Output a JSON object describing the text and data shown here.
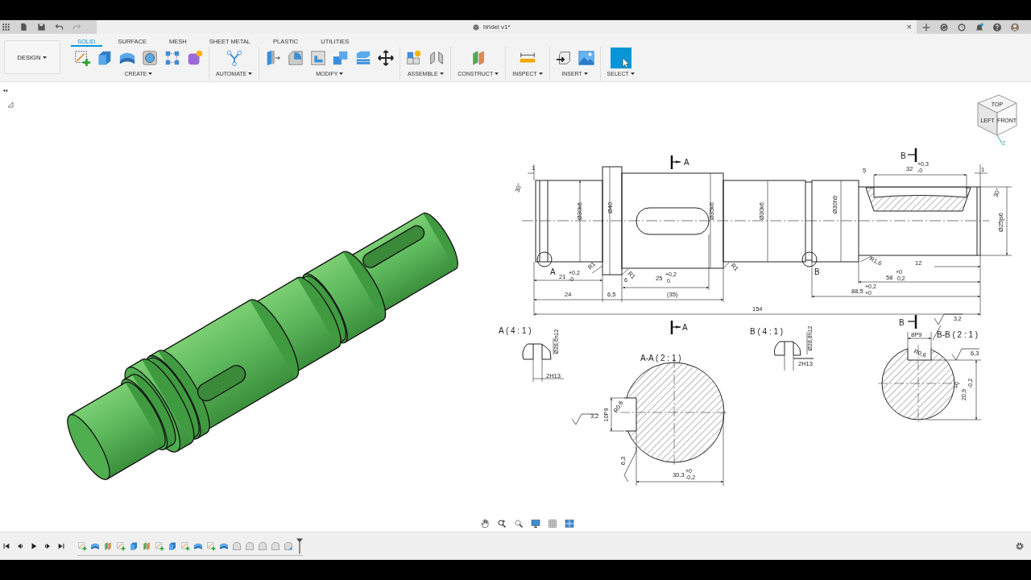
{
  "window": {
    "title": "hřídel v1*",
    "close_symbol": "×"
  },
  "workspace": {
    "label": "DESIGN"
  },
  "tabs": [
    {
      "label": "SOLID",
      "selected": true
    },
    {
      "label": "SURFACE",
      "selected": false
    },
    {
      "label": "MESH",
      "selected": false
    },
    {
      "label": "SHEET METAL",
      "selected": false
    },
    {
      "label": "PLASTIC",
      "selected": false
    },
    {
      "label": "UTILITIES",
      "selected": false
    }
  ],
  "tool_groups": [
    {
      "label": "CREATE"
    },
    {
      "label": "AUTOMATE"
    },
    {
      "label": "MODIFY"
    },
    {
      "label": "ASSEMBLE"
    },
    {
      "label": "CONSTRUCT"
    },
    {
      "label": "INSPECT"
    },
    {
      "label": "INSERT"
    },
    {
      "label": "SELECT"
    }
  ],
  "view_cube": {
    "faces": [
      "TOP",
      "LEFT",
      "FRONT"
    ],
    "axis": "Z"
  },
  "drawing": {
    "labels": [
      {
        "text": "A",
        "kind": "view"
      },
      {
        "text": "B",
        "kind": "view"
      },
      {
        "text": "1",
        "kind": "dim"
      },
      {
        "text": "30°",
        "kind": "dim"
      },
      {
        "text": "Ø30k6",
        "kind": "dim"
      },
      {
        "text": "Ø40",
        "kind": "dim"
      },
      {
        "text": "Ø35k6",
        "kind": "dim"
      },
      {
        "text": "Ø30k6",
        "kind": "dim"
      },
      {
        "text": "Ø30h9",
        "kind": "dim"
      },
      {
        "text": "5",
        "kind": "dim"
      },
      {
        "text": "32",
        "kind": "dim"
      },
      {
        "text": "+0,3",
        "kind": "tol"
      },
      {
        "text": "-0",
        "kind": "tol"
      },
      {
        "text": "1",
        "kind": "dim"
      },
      {
        "text": "30°",
        "kind": "dim"
      },
      {
        "text": "Ø25js6",
        "kind": "dim"
      },
      {
        "text": "A",
        "kind": "view"
      },
      {
        "text": "R1",
        "kind": "dim"
      },
      {
        "text": "21",
        "kind": "dim"
      },
      {
        "text": "+0,2",
        "kind": "tol"
      },
      {
        "text": "-0",
        "kind": "tol"
      },
      {
        "text": "R1",
        "kind": "dim"
      },
      {
        "text": "6",
        "kind": "tol"
      },
      {
        "text": "25",
        "kind": "dim"
      },
      {
        "text": "+0,2",
        "kind": "tol"
      },
      {
        "text": "0",
        "kind": "tol"
      },
      {
        "text": "R1",
        "kind": "dim"
      },
      {
        "text": "B",
        "kind": "view"
      },
      {
        "text": "R1,6",
        "kind": "dim"
      },
      {
        "text": "12",
        "kind": "dim"
      },
      {
        "text": "58",
        "kind": "dim"
      },
      {
        "text": "+0",
        "kind": "tol"
      },
      {
        "text": "0,2",
        "kind": "tol"
      },
      {
        "text": "24",
        "kind": "dim"
      },
      {
        "text": "6,5",
        "kind": "dim"
      },
      {
        "text": "(35)",
        "kind": "dim"
      },
      {
        "text": "88,5",
        "kind": "dim"
      },
      {
        "text": "+0,2",
        "kind": "tol"
      },
      {
        "text": "+0",
        "kind": "tol"
      },
      {
        "text": "154",
        "kind": "dim"
      },
      {
        "text": "A ( 4 : 1 )",
        "kind": "view"
      },
      {
        "text": "Ø28,6h12",
        "kind": "tol"
      },
      {
        "text": "2H13",
        "kind": "dim"
      },
      {
        "text": "A",
        "kind": "view"
      },
      {
        "text": "A-A ( 2 : 1 )",
        "kind": "view"
      },
      {
        "text": "B ( 4 : 1 )",
        "kind": "view"
      },
      {
        "text": "Ø28,8h12",
        "kind": "tol"
      },
      {
        "text": "2H13",
        "kind": "dim"
      },
      {
        "text": "B",
        "kind": "view"
      },
      {
        "text": "3,2",
        "kind": "tol"
      },
      {
        "text": "8P9",
        "kind": "dim"
      },
      {
        "text": "B-B ( 2 : 1 )",
        "kind": "view"
      },
      {
        "text": "R0,6",
        "kind": "dim"
      },
      {
        "text": "6,3",
        "kind": "dim"
      },
      {
        "text": "20,9",
        "kind": "dim"
      },
      {
        "text": "+0",
        "kind": "tol"
      },
      {
        "text": "-0,2",
        "kind": "tol"
      },
      {
        "text": "3,2",
        "kind": "dim"
      },
      {
        "text": "10P9",
        "kind": "dim"
      },
      {
        "text": "R0,6",
        "kind": "dim"
      },
      {
        "text": "6,3",
        "kind": "dim"
      },
      {
        "text": "30,3",
        "kind": "dim"
      },
      {
        "text": "+0",
        "kind": "tol"
      },
      {
        "text": "-0,2",
        "kind": "tol"
      }
    ]
  }
}
